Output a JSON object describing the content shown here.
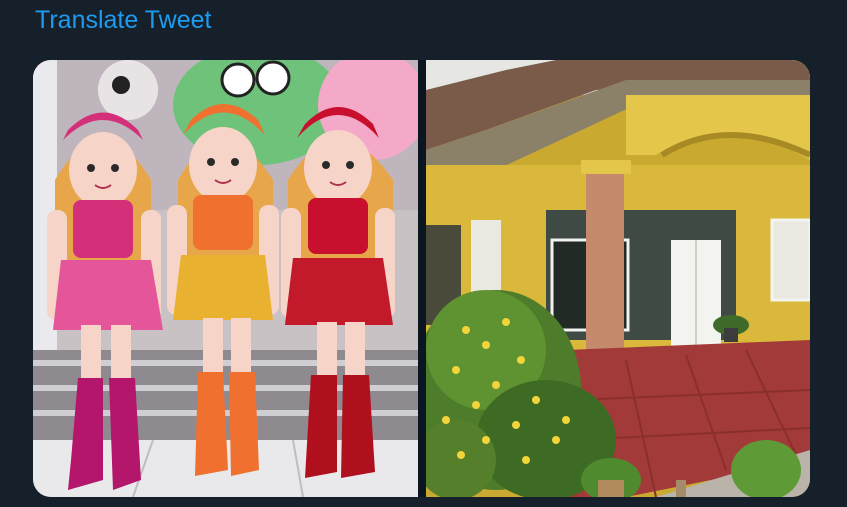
{
  "tweet": {
    "translate_label": "Translate Tweet"
  },
  "media": {
    "photos": [
      {
        "name": "dolls-photo",
        "icon": "image"
      },
      {
        "name": "house-porch-photo",
        "icon": "image"
      }
    ]
  },
  "colors": {
    "background": "#15202b",
    "link": "#1d9bf0",
    "doll_pink": "#d4307a",
    "doll_orange": "#f07030",
    "doll_red": "#c8102e",
    "house_yellow": "#d8b63a",
    "porch_tile": "#a33a3a"
  }
}
